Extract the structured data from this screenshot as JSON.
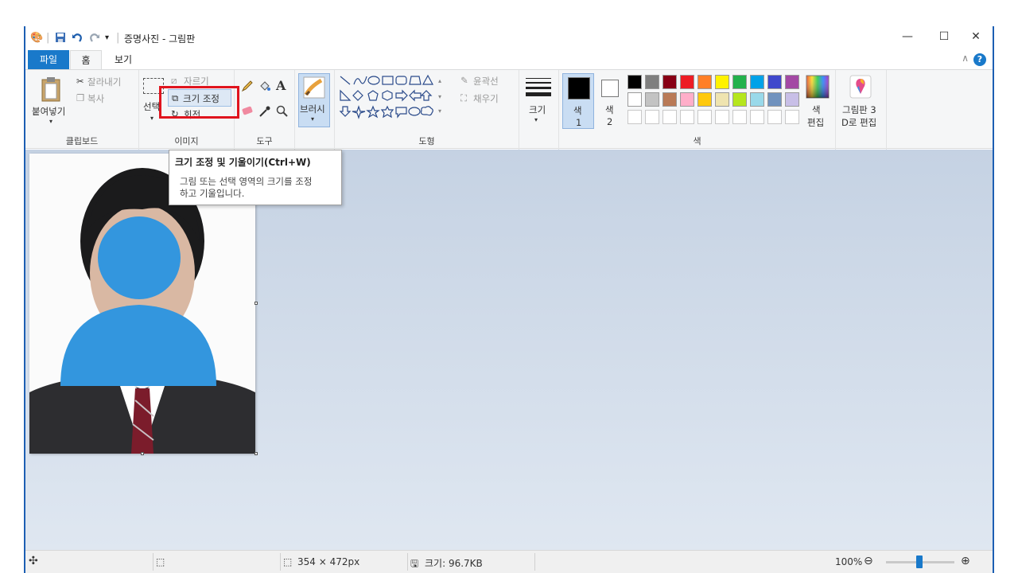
{
  "window": {
    "title": "증명사진 - 그림판",
    "minimize": "—",
    "maximize": "☐",
    "close": "✕"
  },
  "quick_access": {
    "app_icon": "paint-icon",
    "save_icon": "save-icon",
    "undo_icon": "undo-icon",
    "redo_icon": "redo-icon",
    "customize": "▾"
  },
  "tabs": {
    "file": "파일",
    "home": "홈",
    "view": "보기",
    "help": "?"
  },
  "clipboard": {
    "paste": "붙여넣기",
    "cut": "잘라내기",
    "copy": "복사",
    "label": "클립보드"
  },
  "image": {
    "select": "선택",
    "crop": "자르기",
    "resize": "크기 조정",
    "rotate": "회전",
    "label": "이미지"
  },
  "tools": {
    "label": "도구",
    "text_tool": "A"
  },
  "brushes": {
    "label": "브러시"
  },
  "shapes": {
    "outline": "윤곽선",
    "fill": "채우기",
    "label": "도형"
  },
  "size": {
    "label": "크기"
  },
  "colors": {
    "color1": "색",
    "color1_num": "1",
    "color2": "색",
    "color2_num": "2",
    "edit_colors_line1": "색",
    "edit_colors_line2": "편집",
    "label": "색",
    "color1_value": "#000000",
    "color2_value": "#ffffff",
    "palette_row1": [
      "#000000",
      "#7f7f7f",
      "#880015",
      "#ed1c24",
      "#ff7f27",
      "#fff200",
      "#22b14c",
      "#00a2e8",
      "#3f48cc",
      "#a349a4"
    ],
    "palette_row2": [
      "#ffffff",
      "#c3c3c3",
      "#b97a57",
      "#ffaec9",
      "#ffc90e",
      "#efe4b0",
      "#b5e61d",
      "#99d9ea",
      "#7092be",
      "#c8bfe7"
    ]
  },
  "paint3d": {
    "line1": "그림판 3",
    "line2": "D로 편집"
  },
  "tooltip": {
    "title": "크기 조정 및 기울이기(Ctrl+W)",
    "line1": "그림 또는 선택 영역의 크기를 조정",
    "line2": "하고 기울입니다."
  },
  "status": {
    "dimensions": "354 × 472px",
    "file_size": "크기: 96.7KB",
    "zoom": "100%"
  }
}
